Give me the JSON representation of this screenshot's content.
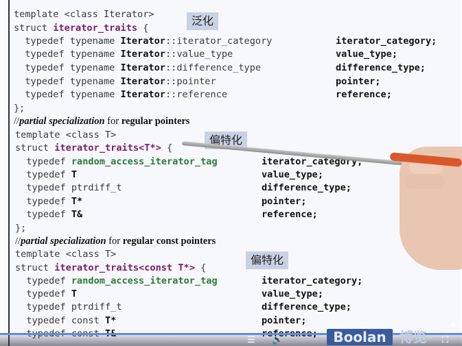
{
  "block1": {
    "l1": "template <class Iterator>",
    "l2a": "struct ",
    "l2b": "iterator_traits",
    "l2c": " {",
    "rows": [
      {
        "a": "  typedef typename ",
        "b": "Iterator",
        "c": "::iterator_category",
        "r": "iterator_category;"
      },
      {
        "a": "  typedef typename ",
        "b": "Iterator",
        "c": "::value_type",
        "r": "value_type;"
      },
      {
        "a": "  typedef typename ",
        "b": "Iterator",
        "c": "::difference_type",
        "r": "difference_type;"
      },
      {
        "a": "  typedef typename ",
        "b": "Iterator",
        "c": "::pointer",
        "r": "pointer;"
      },
      {
        "a": "  typedef typename ",
        "b": "Iterator",
        "c": "::reference",
        "r": "reference;"
      }
    ],
    "close": "};",
    "tag": "泛化"
  },
  "comment1": {
    "slash": "//",
    "italic": "partial specialization",
    "plain": " for ",
    "bold": "regular pointers"
  },
  "block2": {
    "l1": "template <class T>",
    "l2a": "struct ",
    "l2b": "iterator_traits<T*>",
    "l2c": " {",
    "tag": "偏特化",
    "rows": [
      {
        "a": "  typedef ",
        "b": "random_access_iterator_tag",
        "r": "iterator_category;"
      },
      {
        "a": "  typedef ",
        "b": "T",
        "r": "value_type;"
      },
      {
        "a": "  typedef ptrdiff_t",
        "b": "",
        "r": "difference_type;"
      },
      {
        "a": "  typedef ",
        "b": "T*",
        "r": "pointer;"
      },
      {
        "a": "  typedef ",
        "b": "T&",
        "r": "reference;"
      }
    ],
    "close": "};"
  },
  "comment2": {
    "slash": "//",
    "italic": "partial specialization",
    "plain": " for ",
    "bold": "regular const pointers"
  },
  "block3": {
    "l1": "template <class T>",
    "l2a": "struct ",
    "l2b": "iterator_traits<const T*>",
    "l2c": " {",
    "tag": "偏特化",
    "rows": [
      {
        "a": "  typedef ",
        "b": "random_access_iterator_tag",
        "r": "iterator_category;"
      },
      {
        "a": "  typedef ",
        "b": "T",
        "r": "value_type;"
      },
      {
        "a": "  typedef ptrdiff_t",
        "b": "",
        "r": "difference_type;"
      },
      {
        "a": "  typedef const ",
        "b": "T*",
        "r": "pointer;"
      },
      {
        "a": "  typedef const ",
        "b": "T&",
        "r": "reference;"
      }
    ]
  },
  "player": {
    "logo": "Boolan",
    "logo_cn": "博览",
    "icons": [
      "danmaku-icon",
      "volume-icon",
      "fullscreen-icon"
    ],
    "progress_color": "#5d8de0"
  }
}
